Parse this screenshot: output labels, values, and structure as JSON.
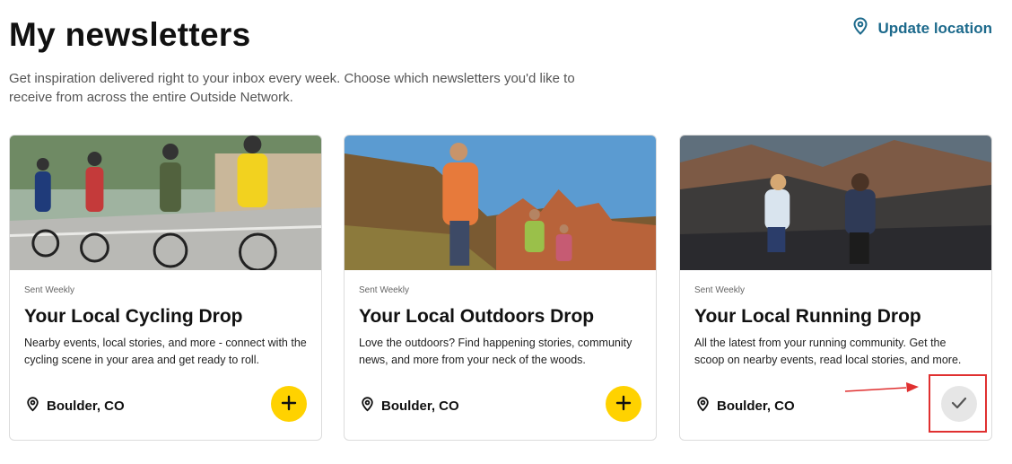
{
  "header": {
    "title": "My newsletters",
    "update_location_label": "Update location",
    "intro": "Get inspiration delivered right to your inbox every week. Choose which newsletters you'd like to receive from across the entire Outside Network."
  },
  "cards": [
    {
      "frequency": "Sent Weekly",
      "title": "Your Local Cycling Drop",
      "description": "Nearby events, local stories, and more - connect with the cycling scene in your area and get ready to roll.",
      "location": "Boulder, CO",
      "subscribed": false,
      "image_subject": "group of road cyclists riding on a sunny road"
    },
    {
      "frequency": "Sent Weekly",
      "title": "Your Local Outdoors Drop",
      "description": "Love the outdoors? Find happening stories, community news, and more from your neck of the woods.",
      "location": "Boulder, CO",
      "subscribed": false,
      "image_subject": "hikers with backpacks among red rock formations"
    },
    {
      "frequency": "Sent Weekly",
      "title": "Your Local Running Drop",
      "description": "All the latest from your running community. Get the scoop on nearby events, read local stories, and more.",
      "location": "Boulder, CO",
      "subscribed": true,
      "image_subject": "two trail runners with mountains behind"
    }
  ],
  "colors": {
    "accent_yellow": "#ffd200",
    "link_blue": "#1d6a8c",
    "subscribed_gray": "#e6e6e6",
    "annotation_red": "#e03030"
  },
  "icons": {
    "location": "map-pin-icon",
    "add": "plus-icon",
    "subscribed": "check-icon"
  }
}
